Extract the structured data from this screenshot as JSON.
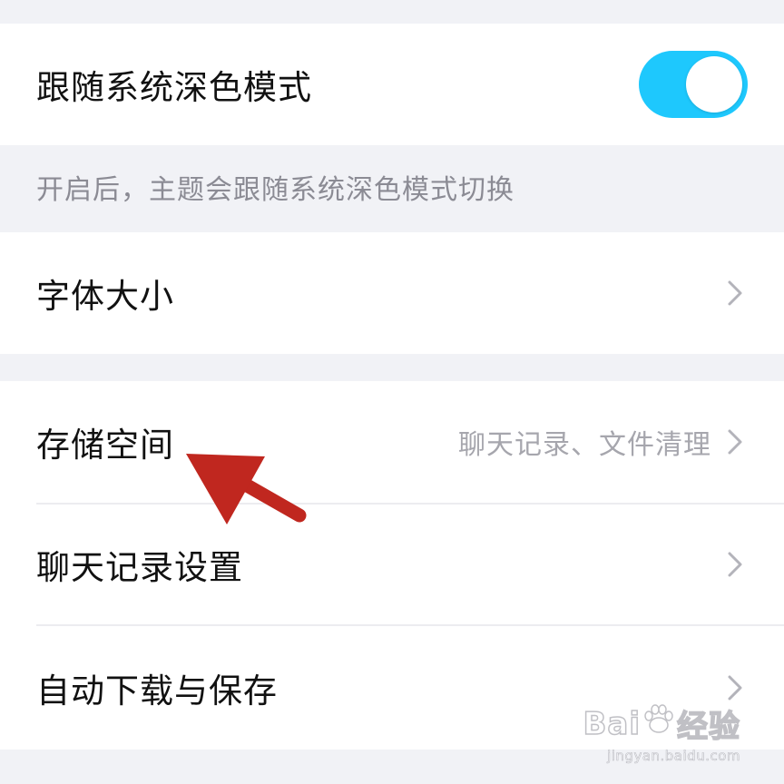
{
  "colors": {
    "accent": "#1ec8fd",
    "annotation_arrow": "#c0271f"
  },
  "settings": {
    "dark_mode": {
      "label": "跟随系统深色模式",
      "enabled": true,
      "hint": "开启后，主题会跟随系统深色模式切换"
    },
    "font_size": {
      "label": "字体大小",
      "icon": "chevron-right-icon"
    },
    "storage": {
      "label": "存储空间",
      "detail": "聊天记录、文件清理",
      "icon": "chevron-right-icon"
    },
    "chat_history": {
      "label": "聊天记录设置",
      "icon": "chevron-right-icon"
    },
    "auto_download": {
      "label": "自动下载与保存",
      "icon": "chevron-right-icon"
    }
  },
  "annotation": {
    "icon": "red-arrow-icon"
  },
  "watermark": {
    "brand_left": "Bai",
    "brand_right": "经验",
    "url": "jingyan.baidu.com"
  }
}
